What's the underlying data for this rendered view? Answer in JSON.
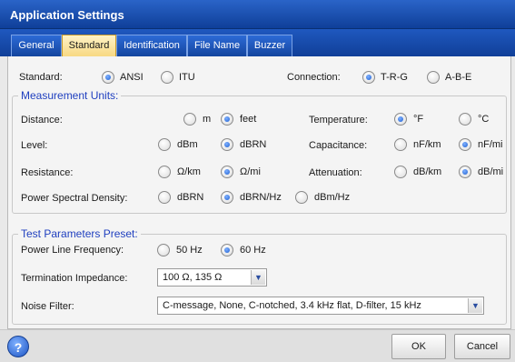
{
  "window": {
    "title": "Application Settings"
  },
  "tabs": [
    {
      "label": "General",
      "active": false
    },
    {
      "label": "Standard",
      "active": true
    },
    {
      "label": "Identification",
      "active": false
    },
    {
      "label": "File Name",
      "active": false
    },
    {
      "label": "Buzzer",
      "active": false
    }
  ],
  "standard": {
    "label": "Standard:",
    "options": [
      {
        "label": "ANSI",
        "checked": true
      },
      {
        "label": "ITU",
        "checked": false
      }
    ]
  },
  "connection": {
    "label": "Connection:",
    "options": [
      {
        "label": "T-R-G",
        "checked": true
      },
      {
        "label": "A-B-E",
        "checked": false
      }
    ]
  },
  "measurement_units": {
    "title": "Measurement Units:",
    "distance": {
      "label": "Distance:",
      "options": [
        {
          "label": "m",
          "checked": false
        },
        {
          "label": "feet",
          "checked": true
        }
      ]
    },
    "temperature": {
      "label": "Temperature:",
      "options": [
        {
          "label": "°F",
          "checked": true
        },
        {
          "label": "°C",
          "checked": false
        }
      ]
    },
    "level": {
      "label": "Level:",
      "options": [
        {
          "label": "dBm",
          "checked": false
        },
        {
          "label": "dBRN",
          "checked": true
        }
      ]
    },
    "capacitance": {
      "label": "Capacitance:",
      "options": [
        {
          "label": "nF/km",
          "checked": false
        },
        {
          "label": "nF/mi",
          "checked": true
        }
      ]
    },
    "resistance": {
      "label": "Resistance:",
      "options": [
        {
          "label": "Ω/km",
          "checked": false
        },
        {
          "label": "Ω/mi",
          "checked": true
        }
      ]
    },
    "attenuation": {
      "label": "Attenuation:",
      "options": [
        {
          "label": "dB/km",
          "checked": false
        },
        {
          "label": "dB/mi",
          "checked": true
        }
      ]
    },
    "psd": {
      "label": "Power Spectral Density:",
      "options": [
        {
          "label": "dBRN",
          "checked": false
        },
        {
          "label": "dBRN/Hz",
          "checked": true
        },
        {
          "label": "dBm/Hz",
          "checked": false
        }
      ]
    }
  },
  "test_params": {
    "title": "Test Parameters Preset:",
    "power_line": {
      "label": "Power Line Frequency:",
      "options": [
        {
          "label": "50 Hz",
          "checked": false
        },
        {
          "label": "60 Hz",
          "checked": true
        }
      ]
    },
    "termination": {
      "label": "Termination Impedance:",
      "value": "100 Ω, 135 Ω"
    },
    "noise_filter": {
      "label": "Noise Filter:",
      "value": "C-message, None, C-notched, 3.4 kHz flat, D-filter, 15 kHz"
    }
  },
  "buttons": {
    "help": "?",
    "ok": "OK",
    "cancel": "Cancel"
  },
  "colors": {
    "titlebar": "#1a50b5",
    "active_tab": "#f7d780",
    "group_title": "#1f3fbf",
    "radio_dot": "#1e5fd1"
  }
}
